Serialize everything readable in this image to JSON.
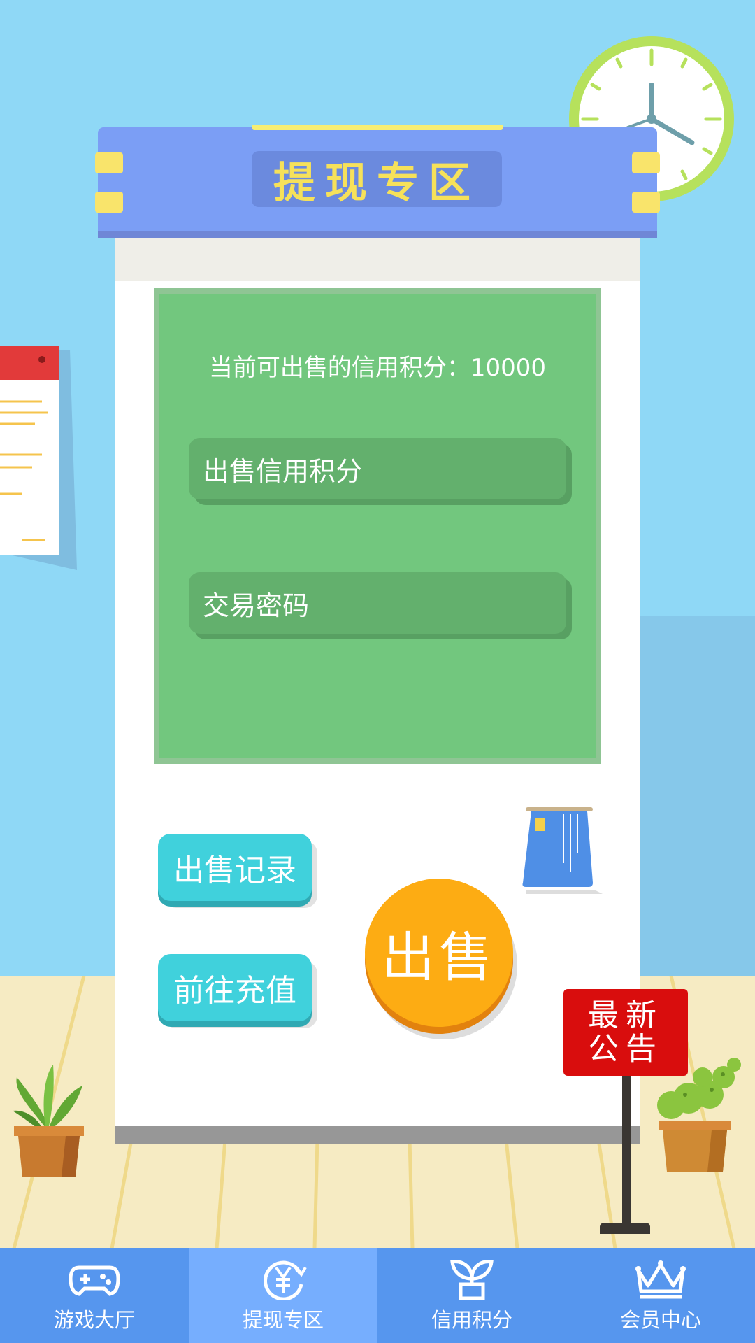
{
  "header": {
    "title": "提现专区"
  },
  "panel": {
    "available_text": "当前可出售的信用积分：10000",
    "sell_points_placeholder": "出售信用积分",
    "password_placeholder": "交易密码"
  },
  "actions": {
    "sell_record": "出售记录",
    "recharge": "前往充值",
    "sell": "出售"
  },
  "notice": {
    "label_line1": "最新",
    "label_line2": "公告"
  },
  "nav": {
    "items": [
      {
        "label": "游戏大厅",
        "icon": "gamepad-icon",
        "active": false
      },
      {
        "label": "提现专区",
        "icon": "yen-exchange-icon",
        "active": true
      },
      {
        "label": "信用积分",
        "icon": "sprout-pot-icon",
        "active": false
      },
      {
        "label": "会员中心",
        "icon": "crown-icon",
        "active": false
      }
    ]
  },
  "colors": {
    "sky": "#8fd8f6",
    "panel_green": "#72c77e",
    "title_yellow": "#f6e15a",
    "cyan": "#40d1dc",
    "orange": "#fdac13",
    "notice_red": "#d90d0d",
    "nav_blue": "#5696ee",
    "nav_active": "#76aefe"
  }
}
